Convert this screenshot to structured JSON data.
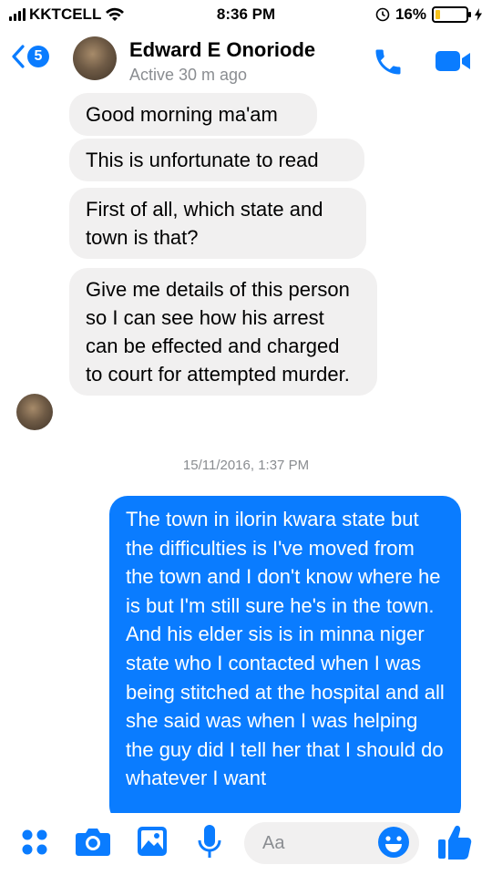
{
  "status_bar": {
    "carrier": "KKTCELL",
    "time": "8:36 PM",
    "battery_percent": "16%",
    "battery_level": 0.16
  },
  "header": {
    "unread_count": "5",
    "contact_name": "Edward E Onoriode",
    "contact_status": "Active 30 m ago"
  },
  "messages": {
    "incoming": [
      "Good morning ma'am",
      "This is unfortunate to read",
      "First of all, which state and town is that?",
      "Give me details of this person so I can see how his arrest can be effected and charged to court for attempted murder."
    ],
    "timestamp": "15/11/2016, 1:37 PM",
    "outgoing": "The town in ilorin kwara state but the difficulties is I've moved from the town and I don't know where he is but I'm still sure he's in the town. And his elder sis is in minna niger state who I contacted when I was being stitched at the hospital and all she said was when I was helping the guy did I tell her that I should do whatever I want"
  },
  "composer": {
    "placeholder": "Aa"
  },
  "colors": {
    "accent": "#0a7cff",
    "incoming_bubble": "#f1f0f0",
    "battery": "#f6c21c"
  },
  "icons": [
    "wifi-icon",
    "alarm-icon",
    "charging-bolt-icon",
    "back-chevron-icon",
    "phone-icon",
    "video-camera-icon",
    "grid-dots-icon",
    "camera-icon",
    "gallery-icon",
    "microphone-icon",
    "emoji-icon",
    "thumbs-up-icon"
  ]
}
